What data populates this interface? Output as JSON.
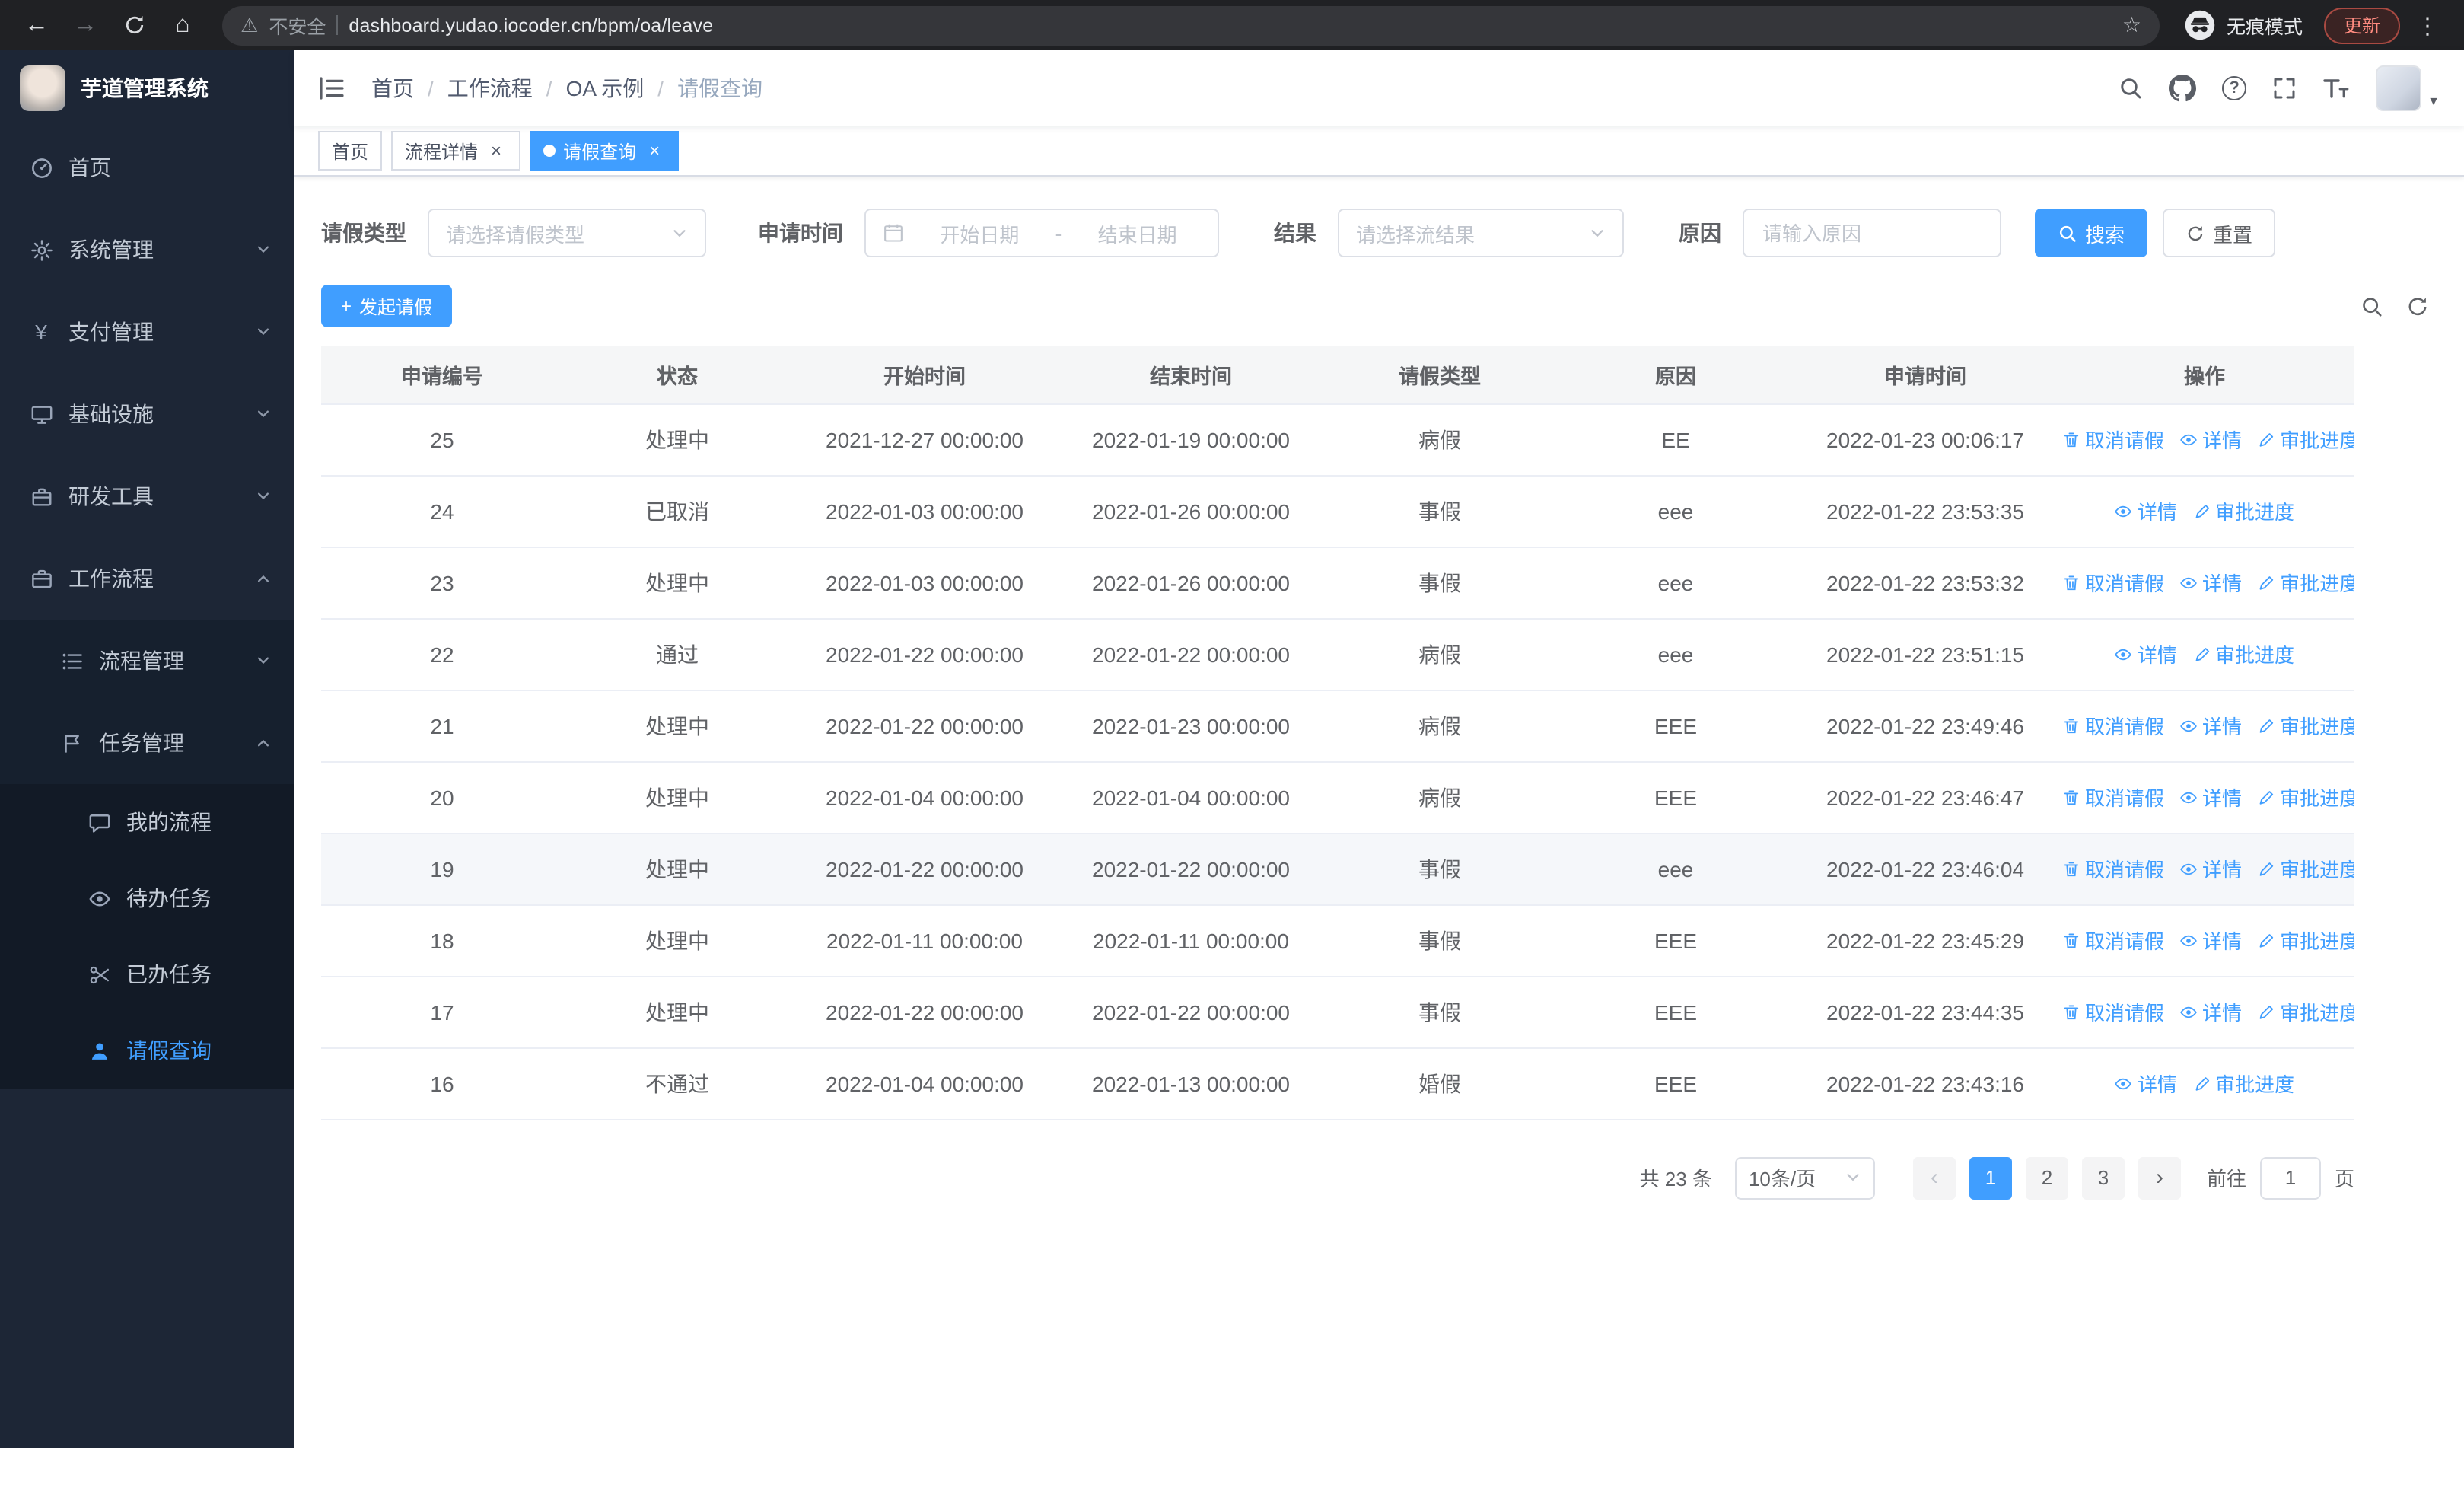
{
  "colors": {
    "primary": "#409eff",
    "sidebar_bg": "#1d2636",
    "chrome_bg": "#202124"
  },
  "icons": {
    "back": "←",
    "forward": "→",
    "home": "⌂",
    "warning": "⚠",
    "star": "☆",
    "dots": "⋮",
    "close": "×",
    "plus": "+",
    "prev": "‹",
    "next": "›",
    "caret": "▼",
    "question": "?",
    "yen": "¥"
  },
  "browser": {
    "security_warning": "不安全",
    "url": "dashboard.yudao.iocoder.cn/bpm/oa/leave",
    "incognito_label": "无痕模式",
    "update_button": "更新"
  },
  "sidebar": {
    "app_title": "芋道管理系统",
    "items": [
      {
        "label": "首页"
      },
      {
        "label": "系统管理"
      },
      {
        "label": "支付管理"
      },
      {
        "label": "基础设施"
      },
      {
        "label": "研发工具"
      },
      {
        "label": "工作流程"
      }
    ],
    "workflow_children": [
      {
        "label": "流程管理"
      },
      {
        "label": "任务管理"
      }
    ],
    "task_children": [
      {
        "label": "我的流程"
      },
      {
        "label": "待办任务"
      },
      {
        "label": "已办任务"
      },
      {
        "label": "请假查询"
      }
    ]
  },
  "breadcrumb": [
    "首页",
    "工作流程",
    "OA 示例",
    "请假查询"
  ],
  "tabs": [
    {
      "label": "首页"
    },
    {
      "label": "流程详情"
    },
    {
      "label": "请假查询"
    }
  ],
  "filters": {
    "leave_type_label": "请假类型",
    "leave_type_placeholder": "请选择请假类型",
    "apply_time_label": "申请时间",
    "start_date_placeholder": "开始日期",
    "range_separator": "-",
    "end_date_placeholder": "结束日期",
    "result_label": "结果",
    "result_placeholder": "请选择流结果",
    "reason_label": "原因",
    "reason_placeholder": "请输入原因",
    "search_button": "搜索",
    "reset_button": "重置"
  },
  "toolbar": {
    "create_button": "发起请假"
  },
  "table": {
    "columns": [
      "申请编号",
      "状态",
      "开始时间",
      "结束时间",
      "请假类型",
      "原因",
      "申请时间",
      "操作"
    ],
    "column_keys": [
      "id",
      "status",
      "start",
      "end",
      "type",
      "reason",
      "applied"
    ],
    "actions": {
      "cancel": "取消请假",
      "detail": "详情",
      "progress": "审批进度"
    },
    "rows": [
      {
        "id": "25",
        "status": "处理中",
        "start": "2021-12-27 00:00:00",
        "end": "2022-01-19 00:00:00",
        "type": "病假",
        "reason": "EE",
        "applied": "2022-01-23 00:06:17",
        "cancelable": true,
        "highlight": false
      },
      {
        "id": "24",
        "status": "已取消",
        "start": "2022-01-03 00:00:00",
        "end": "2022-01-26 00:00:00",
        "type": "事假",
        "reason": "eee",
        "applied": "2022-01-22 23:53:35",
        "cancelable": false,
        "highlight": false
      },
      {
        "id": "23",
        "status": "处理中",
        "start": "2022-01-03 00:00:00",
        "end": "2022-01-26 00:00:00",
        "type": "事假",
        "reason": "eee",
        "applied": "2022-01-22 23:53:32",
        "cancelable": true,
        "highlight": false
      },
      {
        "id": "22",
        "status": "通过",
        "start": "2022-01-22 00:00:00",
        "end": "2022-01-22 00:00:00",
        "type": "病假",
        "reason": "eee",
        "applied": "2022-01-22 23:51:15",
        "cancelable": false,
        "highlight": false
      },
      {
        "id": "21",
        "status": "处理中",
        "start": "2022-01-22 00:00:00",
        "end": "2022-01-23 00:00:00",
        "type": "病假",
        "reason": "EEE",
        "applied": "2022-01-22 23:49:46",
        "cancelable": true,
        "highlight": false
      },
      {
        "id": "20",
        "status": "处理中",
        "start": "2022-01-04 00:00:00",
        "end": "2022-01-04 00:00:00",
        "type": "病假",
        "reason": "EEE",
        "applied": "2022-01-22 23:46:47",
        "cancelable": true,
        "highlight": false
      },
      {
        "id": "19",
        "status": "处理中",
        "start": "2022-01-22 00:00:00",
        "end": "2022-01-22 00:00:00",
        "type": "事假",
        "reason": "eee",
        "applied": "2022-01-22 23:46:04",
        "cancelable": true,
        "highlight": true
      },
      {
        "id": "18",
        "status": "处理中",
        "start": "2022-01-11 00:00:00",
        "end": "2022-01-11 00:00:00",
        "type": "事假",
        "reason": "EEE",
        "applied": "2022-01-22 23:45:29",
        "cancelable": true,
        "highlight": false
      },
      {
        "id": "17",
        "status": "处理中",
        "start": "2022-01-22 00:00:00",
        "end": "2022-01-22 00:00:00",
        "type": "事假",
        "reason": "EEE",
        "applied": "2022-01-22 23:44:35",
        "cancelable": true,
        "highlight": false
      },
      {
        "id": "16",
        "status": "不通过",
        "start": "2022-01-04 00:00:00",
        "end": "2022-01-13 00:00:00",
        "type": "婚假",
        "reason": "EEE",
        "applied": "2022-01-22 23:43:16",
        "cancelable": false,
        "highlight": false
      }
    ]
  },
  "pagination": {
    "total": "共 23 条",
    "page_size": "10条/页",
    "pages": [
      "1",
      "2",
      "3"
    ],
    "active_page": "1",
    "goto_label": "前往",
    "goto_value": "1",
    "goto_unit": "页"
  }
}
